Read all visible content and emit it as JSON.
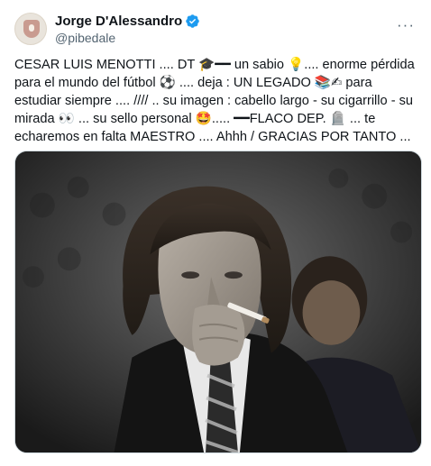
{
  "author": {
    "display_name": "Jorge D'Alessandro",
    "handle": "@pibedale",
    "verified": true,
    "avatar_icon": "profile-logo-icon"
  },
  "more_icon": "more-options-icon",
  "tweet": {
    "text": "CESAR LUIS MENOTTI .... DT 🎓━━ un sabio 💡.... enorme pérdida para el mundo del fútbol ⚽ .... deja : UN LEGADO 📚✍ para estudiar siempre .... //// .. su imagen : cabello largo - su cigarrillo - su mirada 👀 ... su sello personal 🤩..... ━━FLACO DEP. 🪦 ... te echaremos en falta MAESTRO .... Ahhh / GRACIAS POR TANTO ..."
  },
  "media": {
    "type": "photo",
    "icon": "photo-man-smoking-cigarette"
  },
  "colors": {
    "verified_blue": "#1d9bf0",
    "text_primary": "#0f1419",
    "text_secondary": "#536471",
    "border": "#cfd9de"
  }
}
